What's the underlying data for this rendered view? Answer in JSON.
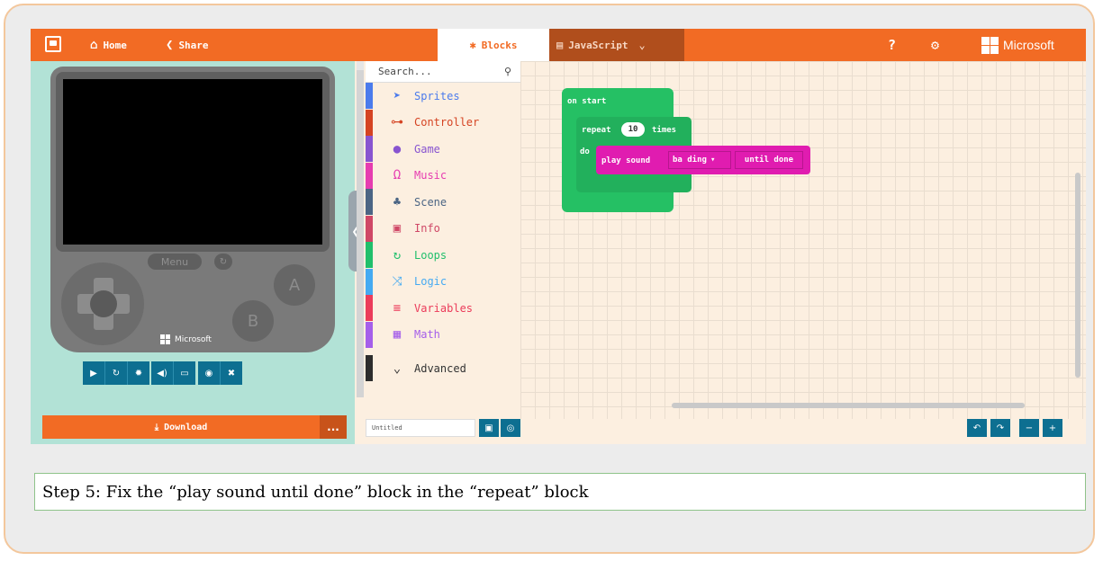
{
  "topbar": {
    "home_label": "Home",
    "share_label": "Share",
    "blocks_tab": "Blocks",
    "javascript_tab": "JavaScript",
    "brand": "Microsoft",
    "accent": "#f26b24"
  },
  "simulator": {
    "menu_label": "Menu",
    "a_label": "A",
    "b_label": "B",
    "brand": "Microsoft",
    "download_label": "Download",
    "more_label": "..."
  },
  "toolbox": {
    "search_placeholder": "Search...",
    "categories": [
      {
        "label": "Sprites",
        "color": "#4b7bec",
        "icon": "paper-plane-icon"
      },
      {
        "label": "Controller",
        "color": "#d54322",
        "icon": "gamepad-icon"
      },
      {
        "label": "Game",
        "color": "#8854d0",
        "icon": "circle-icon"
      },
      {
        "label": "Music",
        "color": "#e63cb0",
        "icon": "headphones-icon"
      },
      {
        "label": "Scene",
        "color": "#4b6584",
        "icon": "tree-icon"
      },
      {
        "label": "Info",
        "color": "#cf4766",
        "icon": "id-card-icon"
      },
      {
        "label": "Loops",
        "color": "#20bf6b",
        "icon": "loop-icon"
      },
      {
        "label": "Logic",
        "color": "#45aaf2",
        "icon": "shuffle-icon"
      },
      {
        "label": "Variables",
        "color": "#eb3b5a",
        "icon": "list-icon"
      },
      {
        "label": "Math",
        "color": "#a55eea",
        "icon": "calculator-icon"
      },
      {
        "label": "Advanced",
        "color": "#2d2d2d",
        "icon": "chevron-down-icon"
      }
    ]
  },
  "workspace": {
    "on_start": "on start",
    "repeat": "repeat",
    "repeat_count": "10",
    "times": "times",
    "do": "do",
    "play_sound": "play sound",
    "sound_name": "ba ding",
    "until_done": "until done",
    "loops_color": "#20bf6b",
    "music_color": "#e01cb0"
  },
  "footer": {
    "project_name": "Untitled"
  },
  "caption": "Step 5: Fix the “play sound until done” block in the “repeat” block"
}
